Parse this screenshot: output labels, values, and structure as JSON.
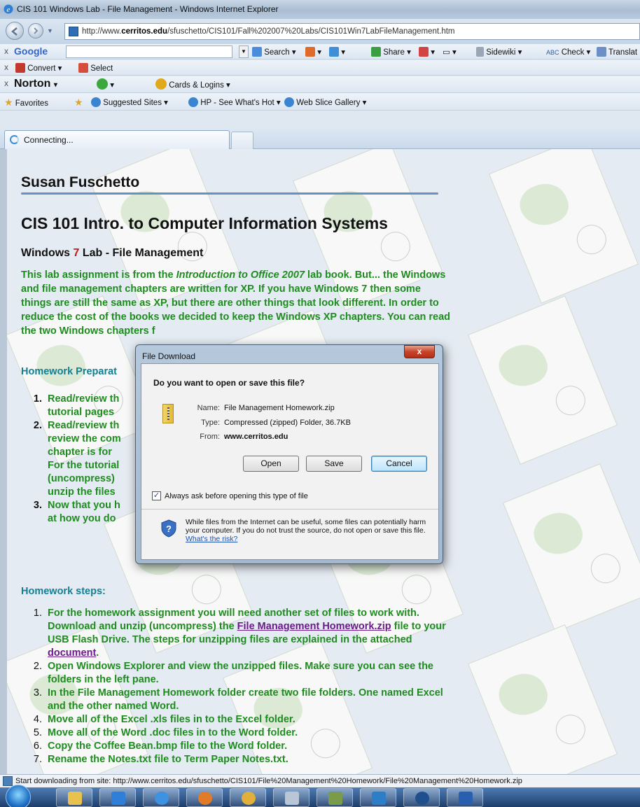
{
  "window": {
    "title": "CIS 101 Windows Lab - File Management - Windows Internet Explorer"
  },
  "address_bar": {
    "url_prefix": "http://www.",
    "url_domain": "cerritos.edu",
    "url_rest": "/sfuschetto/CIS101/Fall%202007%20Labs/CIS101Win7LabFileManagement.htm"
  },
  "google_toolbar": {
    "logo": "Google",
    "search": "Search",
    "share": "Share",
    "sidewiki": "Sidewiki",
    "check": "Check",
    "translate": "Translat"
  },
  "convert_toolbar": {
    "convert": "Convert",
    "select": "Select"
  },
  "norton_toolbar": {
    "logo": "Norton",
    "cards": "Cards & Logins"
  },
  "favorites_bar": {
    "favorites": "Favorites",
    "suggested": "Suggested Sites",
    "hp": "HP - See What's Hot",
    "webslice": "Web Slice Gallery"
  },
  "tab": {
    "label": "Connecting..."
  },
  "page": {
    "author": "Susan Fuschetto",
    "course": "CIS 101 Intro. to Computer Information Systems",
    "lab_prefix": "Windows ",
    "lab_seven": "7",
    "lab_suffix": " Lab - File Management",
    "intro_1": "This lab assignment is from the ",
    "intro_book": "Introduction to Office 2007",
    "intro_2": " lab book.  But... the Windows and file management chapters are written for XP.  If you have Windows 7 then some things are still the same as XP, but there are other things that look different.  In order to reduce the cost of the books we decided to keep the Windows XP chapters.  You can read the two Windows chapters f",
    "prep_heading": "Homework Preparat",
    "prep_items": [
      {
        "num": "1.",
        "text": "Read/review th"
      },
      {
        "num": "",
        "text": "tutorial pages "
      },
      {
        "num": "2.",
        "text": "Read/review th"
      },
      {
        "num": "",
        "text": "review the com"
      },
      {
        "num": "",
        "text": "chapter is for "
      },
      {
        "num": "",
        "text": "For the tutorial"
      },
      {
        "num": "",
        "text": "(uncompress)"
      },
      {
        "num": "",
        "text": "unzip the files"
      },
      {
        "num": "3.",
        "text": "Now that you h"
      },
      {
        "num": "",
        "text": "at how you do"
      }
    ],
    "steps_heading": "Homework steps:",
    "step1_a": "For the homework assignment you will need another set of files to work with.  Download and unzip (uncompress) the ",
    "step1_link": "File Management Homework.zip",
    "step1_b": " file to your USB Flash Drive.  The steps for unzipping files are explained in the attached ",
    "step1_link2": "document",
    "step1_c": ".",
    "steps": [
      {
        "num": "2.",
        "text": "Open Windows Explorer and view the unzipped files.  Make sure you can see the folders in the left pane."
      },
      {
        "num": "3.",
        "text": "In the File Management Homework folder create two file folders.  One named Excel and the other named Word."
      },
      {
        "num": "4.",
        "text": "Move all of the Excel .xls files in to the Excel folder."
      },
      {
        "num": "5.",
        "text": "Move all of the Word .doc files in to the Word folder."
      },
      {
        "num": "6.",
        "text": "Copy the Coffee Bean.bmp file to the Word folder."
      },
      {
        "num": "7.",
        "text": "Rename the Notes.txt file to Term Paper Notes.txt."
      }
    ]
  },
  "dialog": {
    "title": "File Download",
    "close": "x",
    "question": "Do you want to open or save this file?",
    "name_label": "Name:",
    "name_value": "File Management Homework.zip",
    "type_label": "Type:",
    "type_value": "Compressed (zipped) Folder, 36.7KB",
    "from_label": "From:",
    "from_value": "www.cerritos.edu",
    "open": "Open",
    "save": "Save",
    "cancel": "Cancel",
    "always_ask": "Always ask before opening this type of file",
    "always_ask_checked": true,
    "warning": "While files from the Internet can be useful, some files can potentially harm your computer. If you do not trust the source, do not open or save this file. ",
    "risk_link": "What's the risk?"
  },
  "status": {
    "text": "Start downloading from site: http://www.cerritos.edu/sfuschetto/CIS101/File%20Management%20Homework/File%20Management%20Homework.zip"
  },
  "colors": {
    "heading_teal": "#127f92",
    "body_green": "#1f8c1f",
    "accent_red": "#c2181b",
    "link_purple": "#6b1a8a"
  }
}
